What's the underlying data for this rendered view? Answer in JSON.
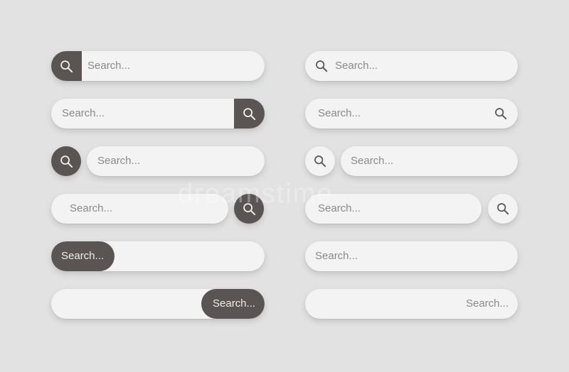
{
  "search": {
    "placeholder": "Search..."
  },
  "colors": {
    "background": "#e2e2e2",
    "bar": "#f3f3f3",
    "accent_dark": "#5a5452",
    "placeholder_text": "#8a8a8a",
    "icon_light_bg": "#f3f3f3"
  },
  "icons": {
    "search": "magnifying-glass"
  },
  "watermark": "dreamstime"
}
